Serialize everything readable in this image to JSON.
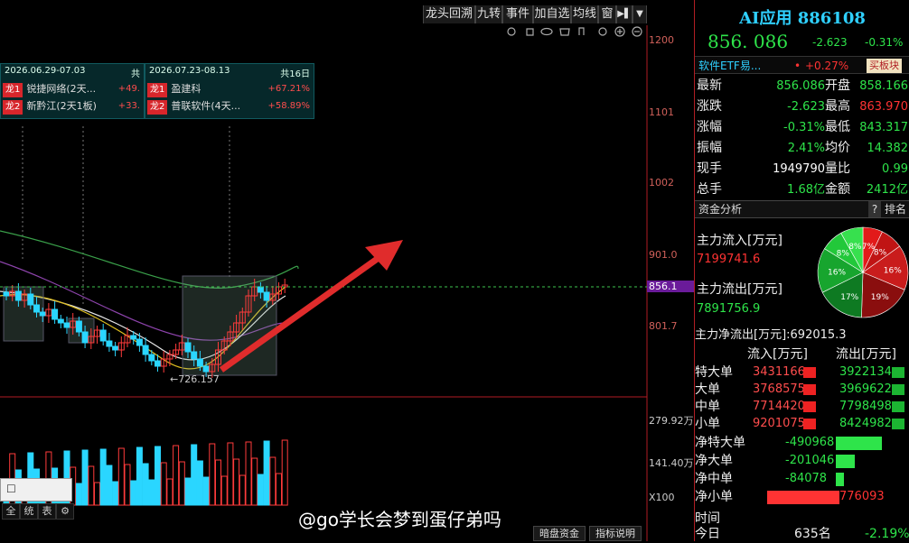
{
  "toolbar": {
    "tabs": [
      "龙头回溯",
      "九转",
      "事件",
      "加自选",
      "均线",
      "窗",
      "▶▌",
      "▼"
    ]
  },
  "ribbons": [
    {
      "range": "2026.06.29-07.03",
      "total": "共",
      "rows": [
        {
          "tag": "龙1",
          "name": "锐捷网络(2天...",
          "pct": "+49."
        },
        {
          "tag": "龙2",
          "name": "新黔江(2天1板)",
          "pct": "+33."
        }
      ]
    },
    {
      "range": "2026.07.23-08.13",
      "total": "共16日",
      "rows": [
        {
          "tag": "龙1",
          "name": "盈建科",
          "pct": "+67.21%"
        },
        {
          "tag": "龙2",
          "name": "普联软件(4天...",
          "pct": "+58.89%"
        }
      ]
    }
  ],
  "price_ticks": [
    "1200",
    "1101",
    "1002",
    "901.0",
    "856.1",
    "801.7"
  ],
  "vol_ticks": [
    "279.92万",
    "141.40万",
    "X100"
  ],
  "low_label": "←726.157",
  "chart_data": {
    "type": "candlestick",
    "current_price": 856.1,
    "low": 726.157,
    "ylim": [
      726,
      1200
    ],
    "volume_ylim": [
      0,
      279.92
    ]
  },
  "quote": {
    "title": "AI应用 886108",
    "price": "856. 086",
    "change": "-2.623",
    "change_pct": "-0.31%",
    "etf_name": "软件ETF易...",
    "etf_pct": "+0.27%",
    "etf_btn": "买板块",
    "rows": [
      {
        "l1": "最新",
        "v1": "856.086",
        "l2": "开盘",
        "v2": "858.166"
      },
      {
        "l1": "涨跌",
        "v1": "-2.623",
        "l2": "最高",
        "v2": "863.970"
      },
      {
        "l1": "涨幅",
        "v1": "-0.31%",
        "l2": "最低",
        "v2": "843.317"
      },
      {
        "l1": "振幅",
        "v1": "2.41%",
        "l2": "均价",
        "v2": "14.382"
      },
      {
        "l1": "现手",
        "v1": "1949790",
        "l2": "量比",
        "v2": "0.99"
      },
      {
        "l1": "总手",
        "v1": "1.68亿",
        "l2": "金额",
        "v2": "2412亿"
      }
    ]
  },
  "funds": {
    "section": "资金分析",
    "q": "?",
    "rank": "排名",
    "inflow_label": "主力流入[万元]",
    "inflow_val": "7199741.6",
    "outflow_label": "主力流出[万元]",
    "outflow_val": "7891756.9",
    "net_label": "主力净流出[万元]:692015.3",
    "pie_slices": [
      {
        "label": "7%",
        "value": 7,
        "color": "#e21a1a"
      },
      {
        "label": "8%",
        "value": 8,
        "color": "#c01414"
      },
      {
        "label": "16%",
        "value": 16,
        "color": "#c91c1c"
      },
      {
        "label": "19%",
        "value": 19,
        "color": "#8a0e0e"
      },
      {
        "label": "17%",
        "value": 17,
        "color": "#0e7a22"
      },
      {
        "label": "16%",
        "value": 16,
        "color": "#17a52e"
      },
      {
        "label": "8%",
        "value": 8,
        "color": "#22c83a"
      },
      {
        "label": "8%",
        "value": 8,
        "color": "#37e04e"
      }
    ],
    "head_in": "流入[万元]",
    "head_out": "流出[万元]",
    "rows": [
      {
        "name": "特大单",
        "in": "3431166",
        "out": "3922134"
      },
      {
        "name": "大单",
        "in": "3768575",
        "out": "3969622"
      },
      {
        "name": "中单",
        "in": "7714420",
        "out": "7798498"
      },
      {
        "name": "小单",
        "in": "9201075",
        "out": "8424982"
      }
    ],
    "net_rows": [
      {
        "name": "净特大单",
        "val": "-490968",
        "color": "#2ee44a"
      },
      {
        "name": "净大单",
        "val": "-201046",
        "color": "#2ee44a"
      },
      {
        "name": "净中单",
        "val": "-84078",
        "color": "#2ee44a"
      },
      {
        "name": "净小单",
        "val": "776093",
        "color": "#ff3333"
      }
    ],
    "time_label": "时间",
    "today_label": "今日",
    "today_extra": "635名",
    "today_pct": "-2.19%"
  },
  "bottom_left_tabs": [
    "全",
    "统",
    "表",
    "⚙"
  ],
  "footer_tabs": [
    "暗盘资金",
    "指标说明"
  ],
  "watermark": "@go学长会梦到蛋仔弟吗"
}
